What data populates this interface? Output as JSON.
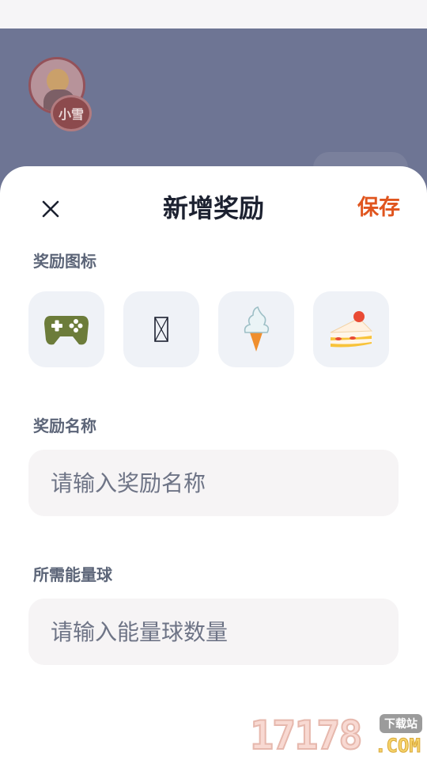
{
  "background": {
    "avatar_name": "小雪"
  },
  "sheet": {
    "title": "新增奖励",
    "save_label": "保存",
    "close_icon": "close-icon"
  },
  "icon_section": {
    "label": "奖励图标",
    "icons": [
      {
        "name": "gamepad-icon"
      },
      {
        "name": "missing-glyph-icon"
      },
      {
        "name": "soft-serve-icon"
      },
      {
        "name": "shortcake-icon"
      }
    ]
  },
  "name_section": {
    "label": "奖励名称",
    "placeholder": "请输入奖励名称"
  },
  "energy_section": {
    "label": "所需能量球",
    "placeholder": "请输入能量球数量"
  },
  "watermark": {
    "digits": "17178",
    "badge": "下载站",
    "com": ".COM"
  },
  "colors": {
    "accent": "#e0551e",
    "backdrop": "#6e7594",
    "tile": "#eff2f7",
    "input": "#f6f4f5"
  }
}
